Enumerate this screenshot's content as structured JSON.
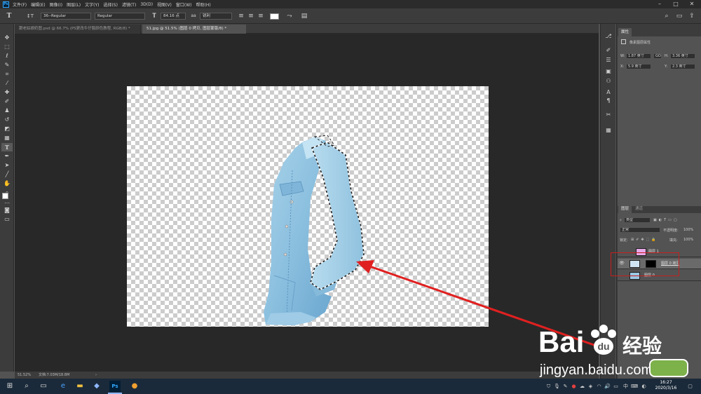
{
  "menubar": {
    "logo": "Ps",
    "items": [
      "文件(F)",
      "编辑(E)",
      "图像(I)",
      "图层(L)",
      "文字(Y)",
      "选择(S)",
      "滤镜(T)",
      "3D(D)",
      "视图(V)",
      "窗口(W)",
      "帮助(H)"
    ]
  },
  "options": {
    "font_family": "36--Regular",
    "font_style": "Regular",
    "font_size": "84.16 点",
    "antialias": "锐利"
  },
  "tabs": [
    {
      "label": "跟老姑娘奶图.psd @ 66.7% (PS更改牛仔服颜色教程, RGB/8) *",
      "active": false
    },
    {
      "label": "51.jpg @ 51.5% (图层 0 拷贝, 图层蒙版/8) *",
      "active": true
    }
  ],
  "status": {
    "zoom": "51.52%",
    "doc": "文档:7.03M/18.8M"
  },
  "properties": {
    "tab_label": "属性",
    "section_title": "像素图层属性",
    "w_label": "W:",
    "w_value": "1.87 英寸",
    "link_label": "GO",
    "h_label": "H:",
    "h_value": "3.36 英寸",
    "x_label": "X:",
    "x_value": "5.9 英寸",
    "y_label": "Y:",
    "y_value": "2.3 英寸"
  },
  "layers_panel": {
    "tab_layers": "图层",
    "tab_channels": "通道",
    "filter_label": "类型",
    "blend_mode": "正常",
    "opacity_label": "不透明度:",
    "opacity_value": "100%",
    "lock_label": "锁定:",
    "fill_label": "填充:",
    "fill_value": "100%",
    "layers": [
      {
        "name": "图层 1",
        "visible": false,
        "selected": false
      },
      {
        "name": "图层 0 拷贝",
        "visible": true,
        "selected": true
      },
      {
        "name": "图层 0",
        "visible": false,
        "selected": false
      }
    ]
  },
  "taskbar": {
    "time": "16:27",
    "date": "2020/3/16"
  },
  "watermark": {
    "brand_left": "Bai",
    "brand_right": "经验",
    "url": "jingyan.baidu.com"
  },
  "colors": {
    "annotation_red": "#e02020",
    "selection_ring": "#c81e1e"
  }
}
